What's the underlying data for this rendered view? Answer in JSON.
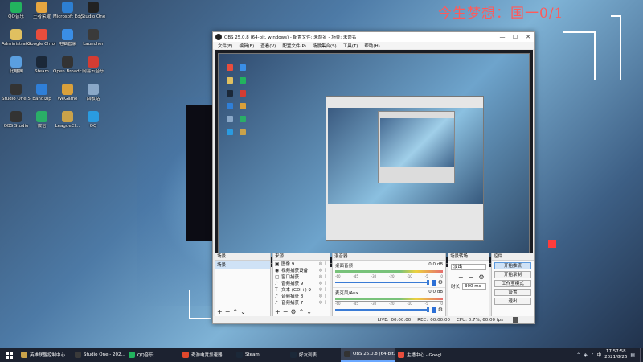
{
  "wallpaper": {
    "text": "今生梦想：国一0/1",
    "accent_color": "#ff5a5a"
  },
  "desktop_icons": [
    {
      "label": "QQ音乐",
      "icon": "qq-music-icon",
      "color": "#22b35e"
    },
    {
      "label": "王者荣耀",
      "icon": "honor-of-kings-icon",
      "color": "#e6a640"
    },
    {
      "label": "Microsoft Edge",
      "icon": "edge-icon",
      "color": "#2d7fd2"
    },
    {
      "label": "Studio One",
      "icon": "studio-one-icon",
      "color": "#222"
    },
    {
      "label": "Administrator",
      "icon": "user-folder-icon",
      "color": "#e0c060"
    },
    {
      "label": "Google Chrome",
      "icon": "chrome-icon",
      "color": "#e84d3d"
    },
    {
      "label": "电脑管家",
      "icon": "pc-manager-icon",
      "color": "#3a8ee6"
    },
    {
      "label": "Launcher",
      "icon": "launcher-icon",
      "color": "#3a3a3a"
    },
    {
      "label": "此电脑",
      "icon": "this-pc-icon",
      "color": "#5a9fe0"
    },
    {
      "label": "Steam",
      "icon": "steam-icon",
      "color": "#1b2838"
    },
    {
      "label": "Open Broadcaster",
      "icon": "obs-icon",
      "color": "#333"
    },
    {
      "label": "网易云音乐",
      "icon": "netease-music-icon",
      "color": "#d43c33"
    },
    {
      "label": "Studio One 5",
      "icon": "studio-one-5-icon",
      "color": "#333"
    },
    {
      "label": "Bandizip",
      "icon": "bandizip-icon",
      "color": "#2f7fd8"
    },
    {
      "label": "WeGame",
      "icon": "wegame-icon",
      "color": "#d9a03b"
    },
    {
      "label": "回收站",
      "icon": "recycle-bin-icon",
      "color": "#8aa8c8"
    },
    {
      "label": "OBS Studio",
      "icon": "obs-studio-icon",
      "color": "#333"
    },
    {
      "label": "微信",
      "icon": "wechat-icon",
      "color": "#2aae67"
    },
    {
      "label": "LeagueCl...",
      "icon": "league-client-icon",
      "color": "#c9a24a"
    },
    {
      "label": "QQ",
      "icon": "qq-icon",
      "color": "#2a9be0"
    }
  ],
  "obs": {
    "title": "OBS 25.0.8 (64-bit, windows) - 配置文件: 未命名 - 场景: 未命名",
    "menus": [
      "文件(F)",
      "编辑(E)",
      "查看(V)",
      "配置文件(P)",
      "场景集合(S)",
      "工具(T)",
      "帮助(H)"
    ],
    "docks": {
      "scenes": {
        "title": "场景",
        "items": [
          "场景"
        ]
      },
      "sources": {
        "title": "来源",
        "items": [
          {
            "name": "图像 9",
            "icon": "image-icon"
          },
          {
            "name": "视频捕获设备",
            "icon": "camera-icon"
          },
          {
            "name": "窗口捕获",
            "icon": "window-capture-icon"
          },
          {
            "name": "音频捕获 9",
            "icon": "audio-icon"
          },
          {
            "name": "文本 (GDI+) 9",
            "icon": "text-icon"
          },
          {
            "name": "音频捕获 8",
            "icon": "audio-icon"
          },
          {
            "name": "音频捕获 7",
            "icon": "audio-icon"
          }
        ]
      },
      "mixer": {
        "title": "混音器",
        "tracks": [
          {
            "name": "桌面音频",
            "db": "0.0 dB"
          },
          {
            "name": "麦克风/Aux",
            "db": "0.0 dB"
          }
        ],
        "tick_labels": [
          "-60",
          "-45",
          "-30",
          "-20",
          "-10",
          "-5",
          "0"
        ]
      },
      "transitions": {
        "title": "场景转场",
        "selected": "淡出",
        "duration_label": "时长",
        "duration_value": "300 ms"
      },
      "controls": {
        "title": "控件",
        "buttons": [
          "开始推流",
          "开始录制",
          "工作室模式",
          "设置",
          "退出"
        ]
      }
    },
    "status": {
      "live_label": "LIVE:",
      "live_time": "00:00:00",
      "rec_label": "REC:",
      "rec_time": "00:00:00",
      "cpu": "CPU: 0.7%, 60.00 fps"
    }
  },
  "taskbar": {
    "items": [
      {
        "label": "英雄联盟控制中心",
        "color": "#c9a24a",
        "active": false
      },
      {
        "label": "Studio One - 202...",
        "color": "#3a3a3a",
        "active": false
      },
      {
        "label": "QQ音乐",
        "color": "#22b35e",
        "active": false
      },
      {
        "label": "奇游电竞加速器",
        "color": "#e0482c",
        "active": false
      },
      {
        "label": "Steam",
        "color": "#1b2838",
        "active": false
      },
      {
        "label": "好友列表",
        "color": "#1b2838",
        "active": false
      },
      {
        "label": "OBS 25.0.8 (64-bit...",
        "color": "#333333",
        "active": true
      },
      {
        "label": "主播中心 - Googl...",
        "color": "#e84d3d",
        "active": false
      }
    ],
    "tray": {
      "lang": "中",
      "time": "17:57:58",
      "date": "2021/8/26"
    }
  }
}
